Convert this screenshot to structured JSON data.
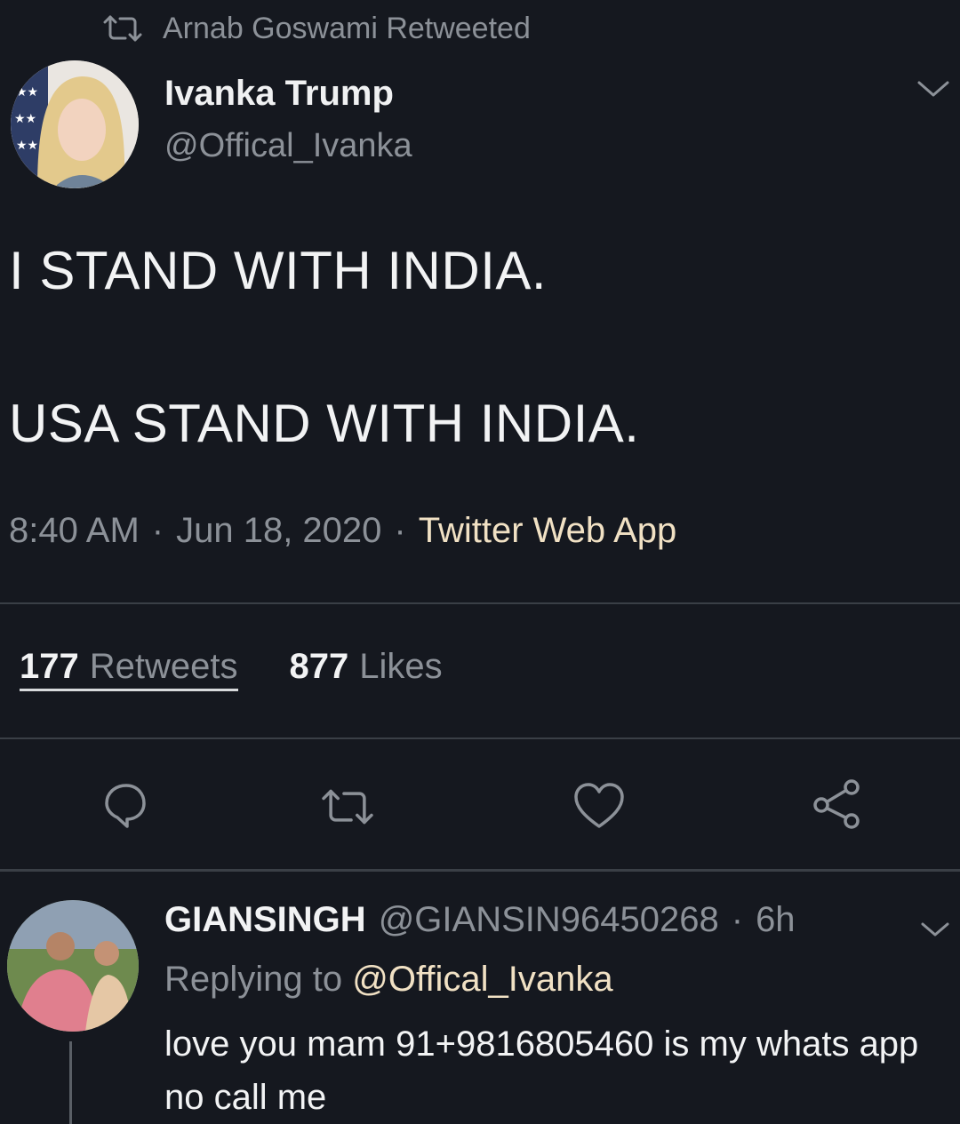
{
  "retweet_header": {
    "text": "Arnab Goswami Retweeted",
    "icon": "retweet-icon"
  },
  "tweet": {
    "author_name": "Ivanka Trump",
    "author_handle": "@Offical_Ivanka",
    "text_line_1": "I STAND WITH INDIA.",
    "text_line_2": "USA STAND WITH INDIA.",
    "time": "8:40 AM",
    "sep1": "·",
    "date": "Jun 18, 2020",
    "sep2": "·",
    "source": "Twitter Web App",
    "retweets_count": "177",
    "retweets_label": "Retweets",
    "likes_count": "877",
    "likes_label": "Likes"
  },
  "actions": [
    "reply-icon",
    "retweet-icon",
    "like-icon",
    "share-icon"
  ],
  "reply": {
    "name": "GIANSINGH",
    "handle": "@GIANSIN96450268",
    "sep": "·",
    "age": "6h",
    "replying_prefix": "Replying to",
    "replying_to": "@Offical_Ivanka",
    "text": "love you mam 91+9816805460 is my whats app no call me"
  },
  "colors": {
    "background": "#15181f",
    "text": "#e8e9ea",
    "muted": "#8c9198",
    "accent": "#f1e1c4",
    "divider": "#3a3f46"
  }
}
